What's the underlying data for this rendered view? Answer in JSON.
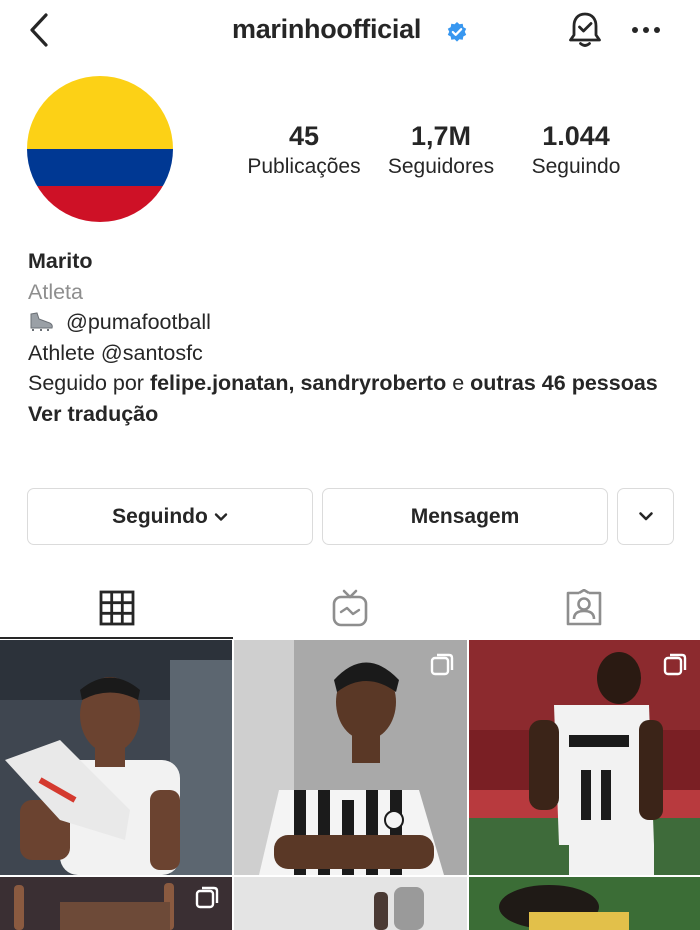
{
  "header": {
    "username": "marinhoofficial",
    "verified": true,
    "icons": [
      "back-arrow-icon",
      "verified-badge-icon",
      "notification-bell-icon",
      "more-options-icon"
    ]
  },
  "profile": {
    "avatar": "colombia-flag-avatar",
    "flag_colors": [
      "#fcd116",
      "#003893",
      "#ce1126"
    ],
    "stats": [
      {
        "value": "45",
        "label": "Publicações"
      },
      {
        "value": "1,7M",
        "label": "Seguidores"
      },
      {
        "value": "1.044",
        "label": "Seguindo"
      }
    ]
  },
  "bio": {
    "name": "Marito",
    "category": "Atleta",
    "line1": "@pumafootball",
    "line2": "Athlete @santosfc",
    "followed_prefix": "Seguido por ",
    "followed_users": "felipe.jonatan, sandryroberto",
    "followed_join": " e ",
    "followed_others": "outras 46 pessoas",
    "translate": "Ver tradução"
  },
  "actions": {
    "following_label": "Seguindo",
    "message_label": "Mensagem"
  },
  "tabs": [
    "grid-posts-icon",
    "igtv-icon",
    "tagged-posts-icon"
  ],
  "posts": [
    {
      "name": "post-player-holding-boots"
    },
    {
      "name": "post-player-santos-jersey"
    },
    {
      "name": "post-player-back-number-11"
    },
    {
      "name": "post-player-pointing"
    },
    {
      "name": "post-player-stadium"
    },
    {
      "name": "post-player-on-pitch"
    }
  ]
}
